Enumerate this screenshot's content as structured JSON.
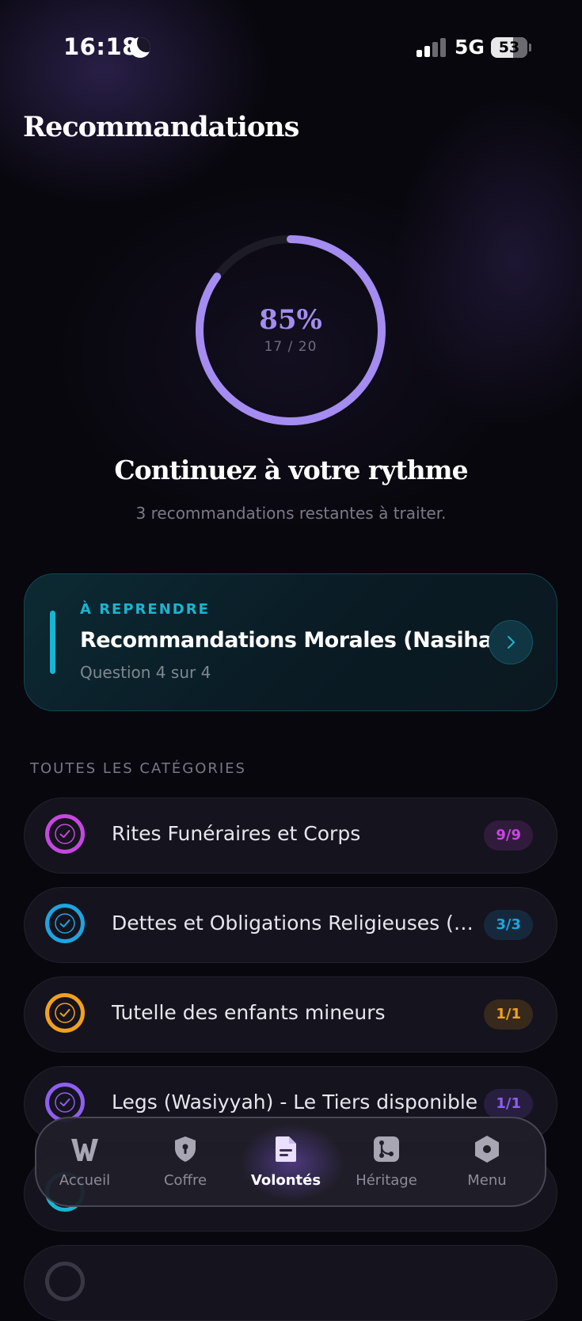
{
  "status_bar": {
    "time": "16:18",
    "network": "5G",
    "battery": "53"
  },
  "page_title": "Recommandations",
  "progress": {
    "percent_label": "85%",
    "fraction_label": "17 / 20",
    "value": 0.85,
    "ring_color": "#a58cf0"
  },
  "headline": "Continuez à votre rythme",
  "subline": "3 recommandations restantes à traiter.",
  "resume": {
    "tag": "À REPRENDRE",
    "title": "Recommandations Morales (Nasiha)",
    "subtitle": "Question 4 sur 4",
    "accent_color": "#17b6d3"
  },
  "section_label": "TOUTES LES CATÉGORIES",
  "categories": [
    {
      "label": "Rites Funéraires et Corps",
      "badge": "9/9",
      "color": "#c548e0"
    },
    {
      "label": "Dettes et Obligations Religieuses (Passif)",
      "badge": "3/3",
      "color": "#1fa4e0"
    },
    {
      "label": "Tutelle des enfants mineurs",
      "badge": "1/1",
      "color": "#f2a11e"
    },
    {
      "label": "Legs (Wasiyyah) - Le Tiers disponible",
      "badge": "1/1",
      "color": "#8e5ff0"
    }
  ],
  "nav": {
    "items": [
      {
        "label": "Accueil",
        "icon": "logo-w-icon"
      },
      {
        "label": "Coffre",
        "icon": "shield-lock-icon"
      },
      {
        "label": "Volontés",
        "icon": "document-icon"
      },
      {
        "label": "Héritage",
        "icon": "branch-icon"
      },
      {
        "label": "Menu",
        "icon": "hexagon-menu-icon"
      }
    ],
    "active": "Volontés"
  }
}
